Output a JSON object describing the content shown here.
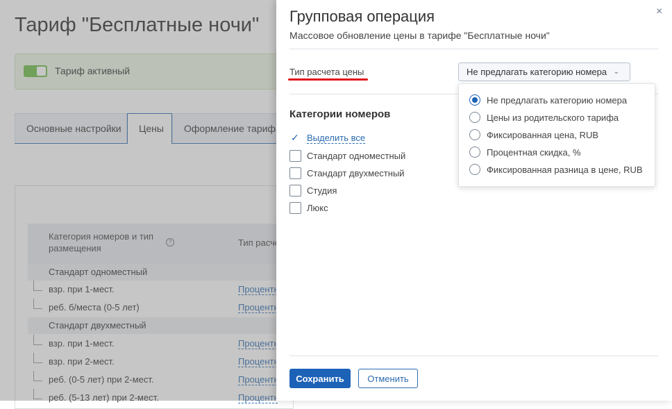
{
  "background": {
    "page_title": "Тариф \"Бесплатные ночи\"",
    "active_label": "Тариф активный",
    "tabs": [
      "Основные настройки",
      "Цены",
      "Оформление тарифа"
    ],
    "table_header": {
      "col1": "Категория номеров и тип размещения",
      "col2": "Тип расчета"
    },
    "groups": [
      {
        "name": "Стандарт одноместный",
        "rows": [
          {
            "label": "взр. при 1-мест.",
            "link": "Процентная скидка"
          },
          {
            "label": "реб. б/места (0-5 лет)",
            "link": "Процентная скидка"
          }
        ]
      },
      {
        "name": "Стандарт двухместный",
        "rows": [
          {
            "label": "взр. при 1-мест.",
            "link": "Процентная скидка"
          },
          {
            "label": "взр. при 2-мест.",
            "link": "Процентная скидка"
          },
          {
            "label": "реб. (0-5 лет) при 2-мест.",
            "link": "Процентная скидка"
          },
          {
            "label": "реб. (5-13 лет) при 2-мест.",
            "link": "Процентная скидка"
          }
        ]
      }
    ]
  },
  "modal": {
    "title": "Групповая операция",
    "subtitle": "Массовое обновление цены в тарифе \"Бесплатные ночи\"",
    "close_icon": "×",
    "calc_type_label": "Тип расчета цены",
    "calc_type_selected": "Не предлагать категорию номера",
    "calc_type_options": [
      "Не предлагать категорию номера",
      "Цены из родительского тарифа",
      "Фиксированная цена, RUB",
      "Процентная скидка, %",
      "Фиксированная разница в цене, RUB"
    ],
    "categories_heading": "Категории номеров",
    "select_all": "Выделить все",
    "categories": [
      "Стандарт одноместный",
      "Стандарт двухместный",
      "Студия",
      "Люкс"
    ],
    "save": "Сохранить",
    "cancel": "Отменить"
  },
  "colors": {
    "primary": "#1c62b7",
    "annotation_red": "#e0141c",
    "toggle_green": "#6dbe45"
  }
}
